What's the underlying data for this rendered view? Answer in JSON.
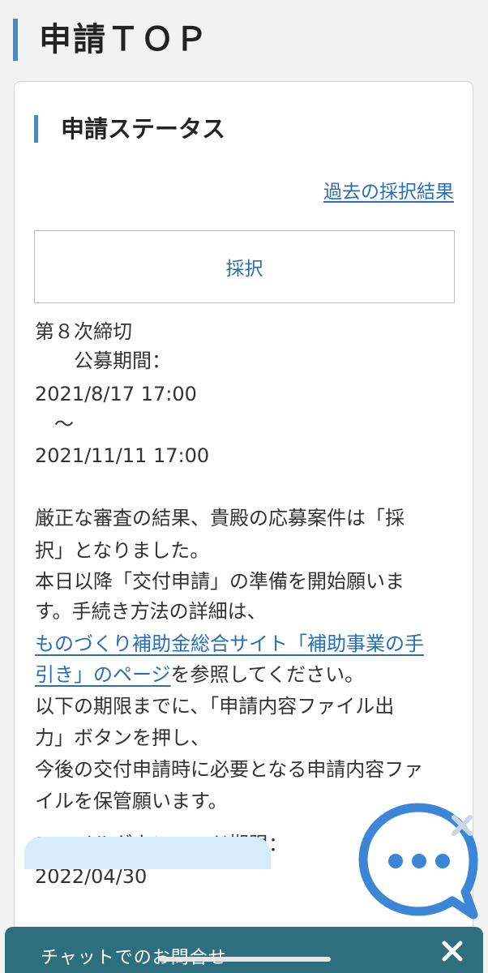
{
  "page_title": "申請ＴＯＰ",
  "section_title": "申請ステータス",
  "past_results_link": "過去の採択結果",
  "status_label": "採択",
  "round": {
    "name": "第８次締切",
    "period_label": "　　公募期間：",
    "start": "2021/8/17 17:00",
    "tilde": "　～",
    "end": "2021/11/11 17:00"
  },
  "message": {
    "line1": "厳正な審査の結果、貴殿の応募案件は「採",
    "line2": "択」となりました。",
    "line3": "本日以降「交付申請」の準備を開始願いま",
    "line4": "す。手続き方法の詳細は、",
    "link_line1": "ものづくり補助金総合サイト「補助事業の手",
    "link_line2": "引き」のページ",
    "after_link": "を参照してください。",
    "line7": "以下の期限までに、「申請内容ファイル出",
    "line8": "力」ボタンを押し、",
    "line9": "今後の交付申請時に必要となる申請内容ファ",
    "line10": "イルを保管願います。"
  },
  "download_deadline_label": "ファイルダウンロード期限：",
  "download_deadline": "2022/04/30",
  "chat_bar_label": "チャットでのお問合せ",
  "colors": {
    "accent": "#4a89b8",
    "link": "#2a6fb6",
    "chat_bar": "#2e6f7e",
    "chat_bubble": "#3b86d6"
  },
  "icons": {
    "chat_bubble": "chat-bubble-icon",
    "close": "close-icon"
  }
}
